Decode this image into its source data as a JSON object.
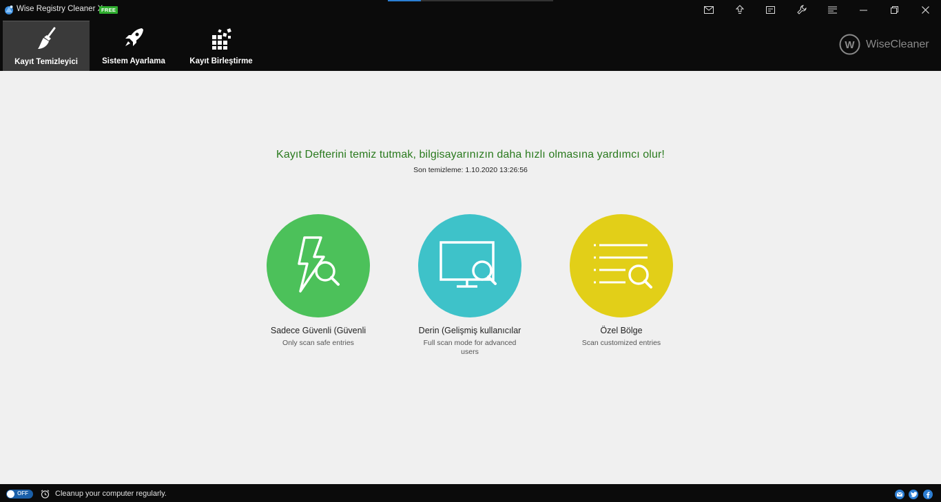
{
  "window": {
    "title": "Wise Registry Cleaner X",
    "badge": "FREE",
    "progress_percent": 20
  },
  "tabs": [
    {
      "label": "Kayıt Temizleyici",
      "icon": "broom-icon",
      "active": true
    },
    {
      "label": "Sistem Ayarlama",
      "icon": "rocket-icon",
      "active": false
    },
    {
      "label": "Kayıt Birleştirme",
      "icon": "defrag-blocks-icon",
      "active": false
    }
  ],
  "brand": {
    "text": "WiseCleaner",
    "logo_letter": "W"
  },
  "main": {
    "headline": "Kayıt Defterini temiz tutmak, bilgisayarınızın daha hızlı olmasına yardımcı olur!",
    "last_clean": "Son temizleme: 1.10.2020 13:26:56"
  },
  "modes": [
    {
      "title": "Sadece Güvenli (Güvenli",
      "desc": "Only scan safe entries",
      "color": "#4cc15a",
      "icon": "lightning-search-icon"
    },
    {
      "title": "Derin (Gelişmiş kullanıcılar",
      "desc": "Full scan mode for advanced users",
      "color": "#3ec2c9",
      "icon": "monitor-search-icon"
    },
    {
      "title": "Özel Bölge",
      "desc": "Scan customized entries",
      "color": "#e2cf18",
      "icon": "list-search-icon"
    }
  ],
  "bottom": {
    "toggle_text": "OFF",
    "message": "Cleanup your computer regularly."
  },
  "colors": {
    "topbar": "#0b0b0b",
    "headline": "#2a7a1e",
    "free_badge": "#2fae2f"
  }
}
